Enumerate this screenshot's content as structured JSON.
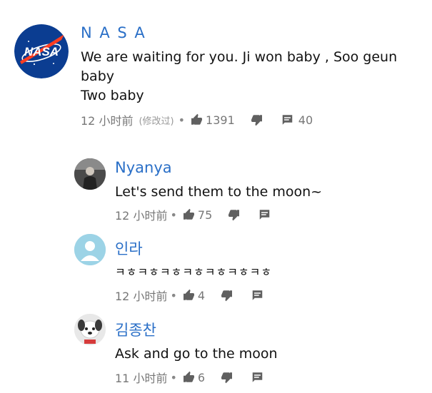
{
  "comments": [
    {
      "author": "N A S A",
      "text_lines": [
        "We are waiting  for you. Ji won baby , Soo geun",
        "baby",
        "Two baby"
      ],
      "time": "12 小时前",
      "edited": "(修改过)",
      "likes": "1391",
      "replies": "40"
    },
    {
      "author": "Nyanya",
      "text": "Let's send them to the moon~",
      "time": "12 小时前",
      "likes": "75"
    },
    {
      "author": "인라",
      "text": "ㅋㅎㅋㅎㅋㅎㅋㅎㅋㅎㅋㅎㅋㅎ",
      "time": "12 小时前",
      "likes": "4"
    },
    {
      "author": "김종찬",
      "text": "Ask and go to the moon",
      "time": "11 小时前",
      "likes": "6"
    }
  ],
  "logo_text": "NASA",
  "colors": {
    "author": "#2a6fc7",
    "nasa_blue": "#0b3d91",
    "nasa_red": "#fc3d21",
    "default_avatar": "#9cd3e6"
  },
  "icons": [
    "like-icon",
    "dislike-icon",
    "reply-icon",
    "nasa-logo",
    "default-avatar-icon"
  ]
}
